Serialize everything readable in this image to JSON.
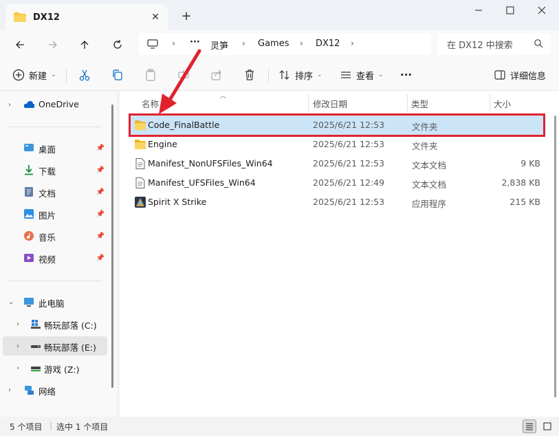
{
  "tab": {
    "title": "DX12",
    "close": "✕",
    "new_tab": "+"
  },
  "window": {
    "minimize": "—",
    "maximize": "☐",
    "close": "✕"
  },
  "address": {
    "ellipsis": "···",
    "segments": [
      "灵笋",
      "Games",
      "DX12"
    ],
    "search_placeholder": "在 DX12 中搜索"
  },
  "toolbar": {
    "new_label": "新建",
    "sort_label": "排序",
    "view_label": "查看",
    "more": "···",
    "details_label": "详细信息"
  },
  "sidebar": {
    "onedrive": "OneDrive",
    "quick": [
      {
        "label": "桌面",
        "icon": "desktop-icon"
      },
      {
        "label": "下载",
        "icon": "download-icon"
      },
      {
        "label": "文档",
        "icon": "document-icon"
      },
      {
        "label": "图片",
        "icon": "pictures-icon"
      },
      {
        "label": "音乐",
        "icon": "music-icon"
      },
      {
        "label": "视频",
        "icon": "video-icon"
      }
    ],
    "this_pc": "此电脑",
    "drives": [
      {
        "label": "畅玩部落 (C:)"
      },
      {
        "label": "畅玩部落 (E:)"
      },
      {
        "label": "游戏 (Z:)"
      }
    ],
    "network": "网络"
  },
  "columns": {
    "name": "名称",
    "modified": "修改日期",
    "type": "类型",
    "size": "大小"
  },
  "files": [
    {
      "name": "Code_FinalBattle",
      "modified": "2025/6/21 12:53",
      "type": "文件夹",
      "size": "",
      "icon": "folder-icon",
      "selected": true
    },
    {
      "name": "Engine",
      "modified": "2025/6/21 12:53",
      "type": "文件夹",
      "size": "",
      "icon": "folder-icon",
      "selected": false
    },
    {
      "name": "Manifest_NonUFSFiles_Win64",
      "modified": "2025/6/21 12:53",
      "type": "文本文档",
      "size": "9 KB",
      "icon": "text-file-icon",
      "selected": false
    },
    {
      "name": "Manifest_UFSFiles_Win64",
      "modified": "2025/6/21 12:49",
      "type": "文本文档",
      "size": "2,838 KB",
      "icon": "text-file-icon",
      "selected": false
    },
    {
      "name": "Spirit X Strike",
      "modified": "2025/6/21 12:53",
      "type": "应用程序",
      "size": "215 KB",
      "icon": "app-icon",
      "selected": false
    }
  ],
  "status": {
    "count": "5 个项目",
    "selected": "选中 1 个项目"
  },
  "colors": {
    "accent": "#0067c0",
    "selection": "#cce4f7",
    "highlight": "#e0222e",
    "folder": "#f8c43f"
  }
}
